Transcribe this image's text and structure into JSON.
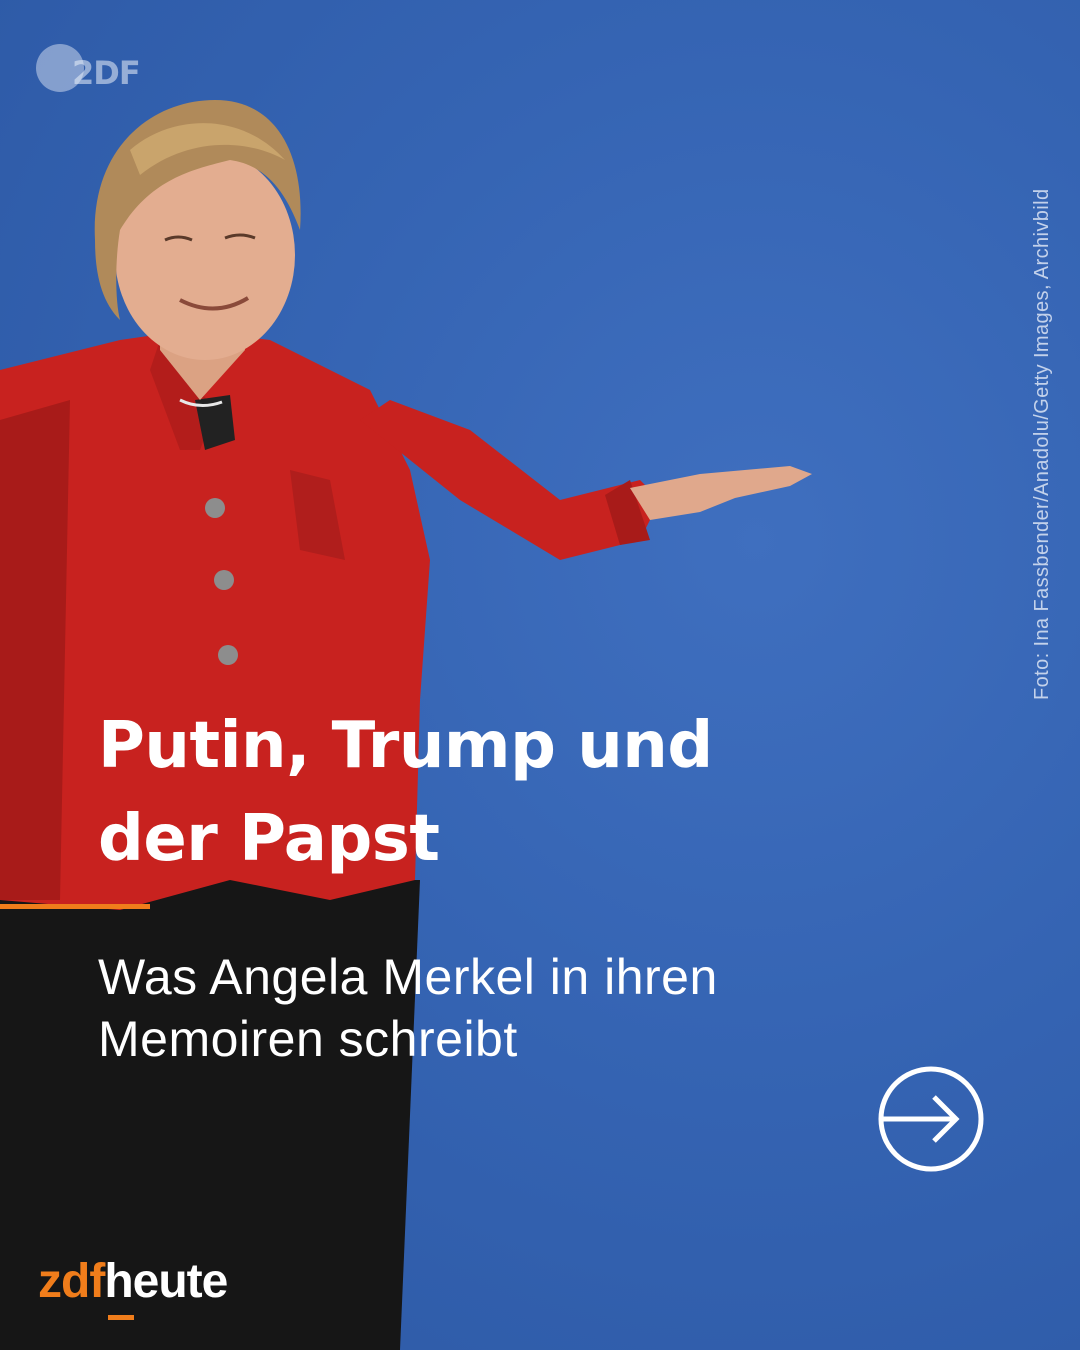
{
  "brand": {
    "watermark": "2DF",
    "logo_zdf": "zdf",
    "logo_heute": "heute",
    "accent_color": "#f07d1b"
  },
  "photo_credit": "Foto: Ina Fassbender/Anadolu/Getty Images, Archivbild",
  "headline": {
    "line1": "Putin, Trump und",
    "line2": "der Papst"
  },
  "subline": {
    "line1": "Was Angela Merkel in ihren",
    "line2": "Memoiren schreibt"
  },
  "next_button": {
    "icon": "arrow-right-circle-icon"
  },
  "colors": {
    "background": "#3564b3",
    "jacket": "#c8221f",
    "text": "#ffffff"
  }
}
